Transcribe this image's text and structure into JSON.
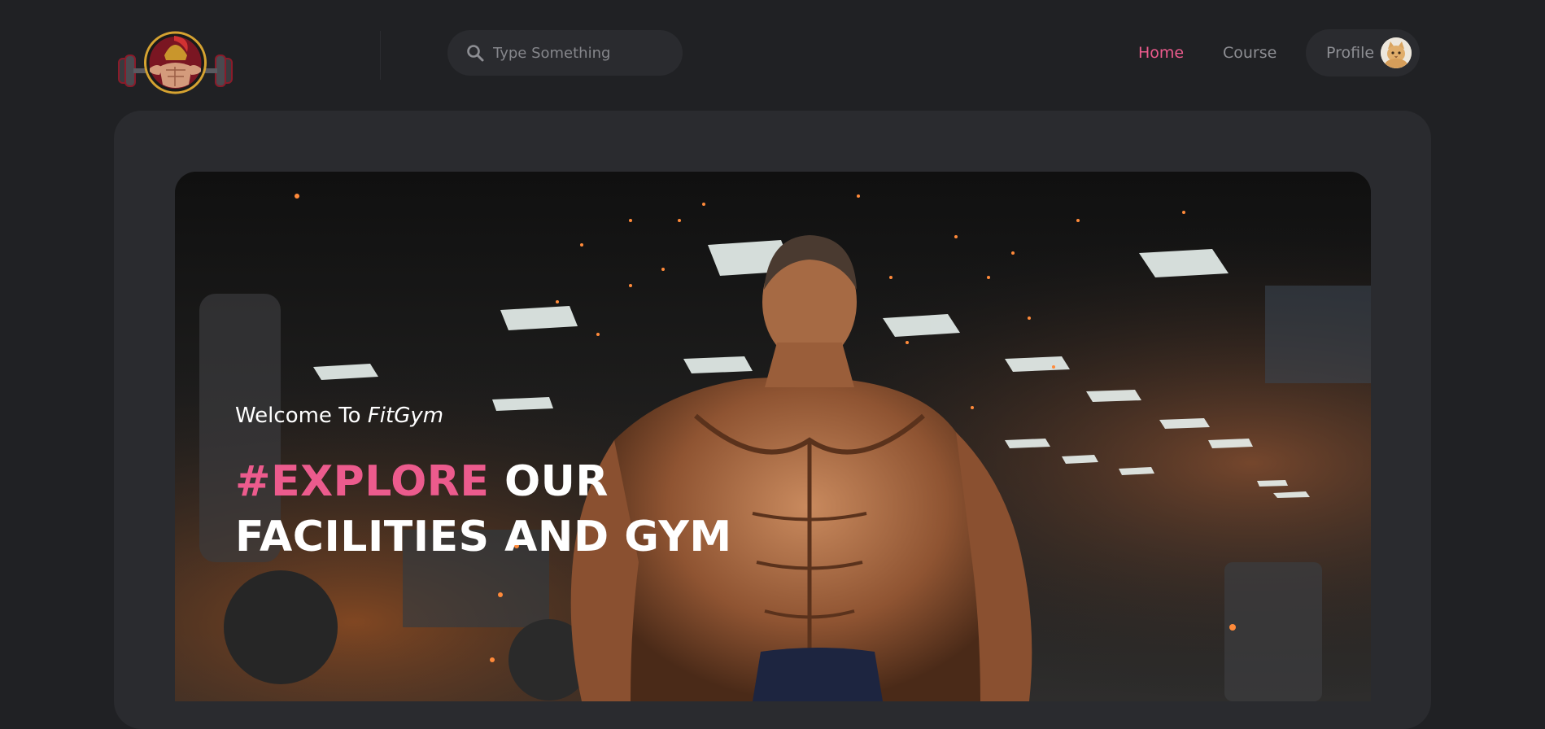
{
  "header": {
    "logo_alt": "Spartan gym logo",
    "search": {
      "placeholder": "Type Something",
      "value": "",
      "icon": "search-icon"
    },
    "nav": [
      {
        "label": "Home",
        "active": true
      },
      {
        "label": "Course",
        "active": false
      }
    ],
    "profile": {
      "label": "Profile",
      "avatar": "cat-avatar"
    }
  },
  "hero": {
    "welcome_prefix": "Welcome To ",
    "welcome_brand": "FitGym",
    "headline_accent": "#EXPLORE",
    "headline_rest": " OUR FACILITIES AND GYM",
    "background": "gym-bodybuilder-photo"
  },
  "colors": {
    "background": "#202124",
    "panel": "#2a2b2f",
    "accent": "#ec5b8d",
    "nav_inactive": "#8d8e93"
  }
}
